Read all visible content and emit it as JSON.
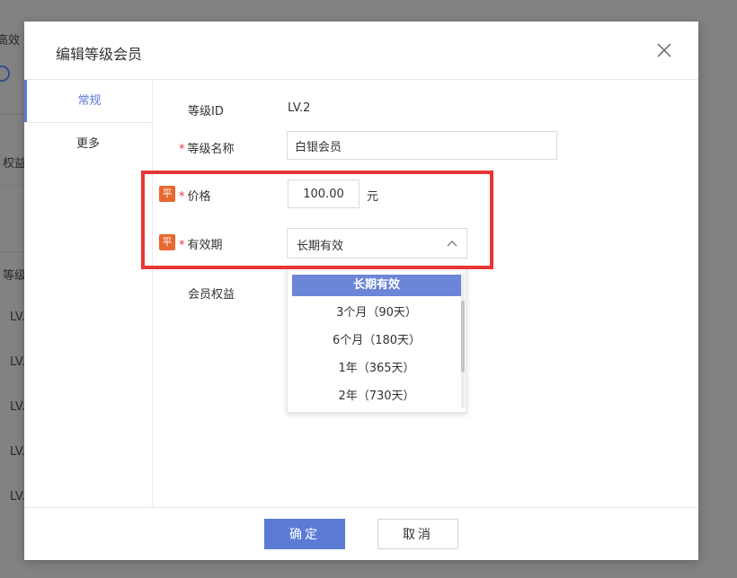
{
  "background": {
    "fragments": [
      "高效",
      "权益",
      "等级",
      "LV.",
      "LV.",
      "LV.",
      "LV.",
      "LV."
    ]
  },
  "modal": {
    "title": "编辑等级会员",
    "close_icon": "close-icon"
  },
  "nav": {
    "items": [
      {
        "label": "常规",
        "active": true
      },
      {
        "label": "更多",
        "active": false
      }
    ]
  },
  "form": {
    "level_id": {
      "label": "等级ID",
      "value": "LV.2"
    },
    "level_name": {
      "label": "等级名称",
      "value": "白银会员",
      "required": true
    },
    "price": {
      "badge": "平",
      "label": "价格",
      "value": "100.00",
      "unit": "元",
      "required": true
    },
    "validity": {
      "badge": "平",
      "label": "有效期",
      "value": "长期有效",
      "required": true
    },
    "benefits": {
      "label": "会员权益"
    }
  },
  "dropdown": {
    "options": [
      "长期有效",
      "3个月（90天）",
      "6个月（180天）",
      "1年（365天）",
      "2年（730天）"
    ],
    "selected_index": 0
  },
  "footer": {
    "confirm_label": "确定",
    "cancel_label": "取消"
  },
  "colors": {
    "accent": "#5b7bd5",
    "badge": "#e8682f",
    "required": "#e4393c",
    "highlight": "#e83535"
  }
}
